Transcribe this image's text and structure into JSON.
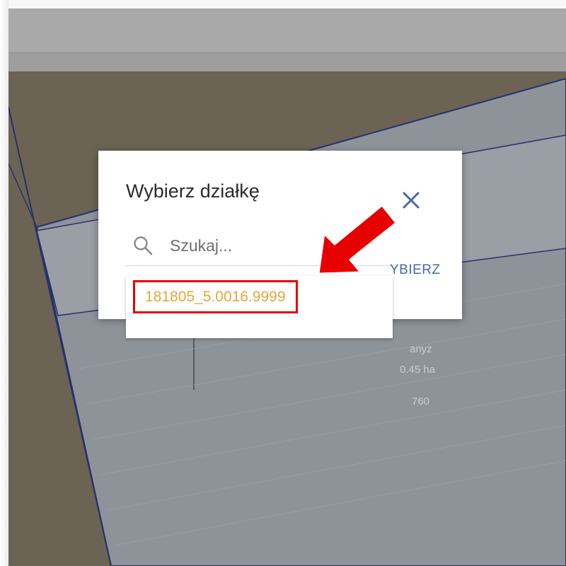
{
  "dialog": {
    "title": "Wybierz działkę",
    "close_icon": "close-icon",
    "search": {
      "placeholder": "Szukaj...",
      "value": "",
      "icon": "search-icon"
    },
    "select_button_label": "YBIERZ"
  },
  "dropdown": {
    "items": [
      {
        "label": "181805_5.0016.9999"
      }
    ]
  },
  "map": {
    "labels": {
      "crop": "anyż",
      "area": "0.45 ha",
      "number": "760"
    }
  },
  "annotation": {
    "arrow_icon": "red-arrow-icon",
    "highlight_color": "#e60000"
  },
  "colors": {
    "accent": "#4a68a8",
    "item_text": "#e7a63a",
    "highlight": "#e60000"
  }
}
